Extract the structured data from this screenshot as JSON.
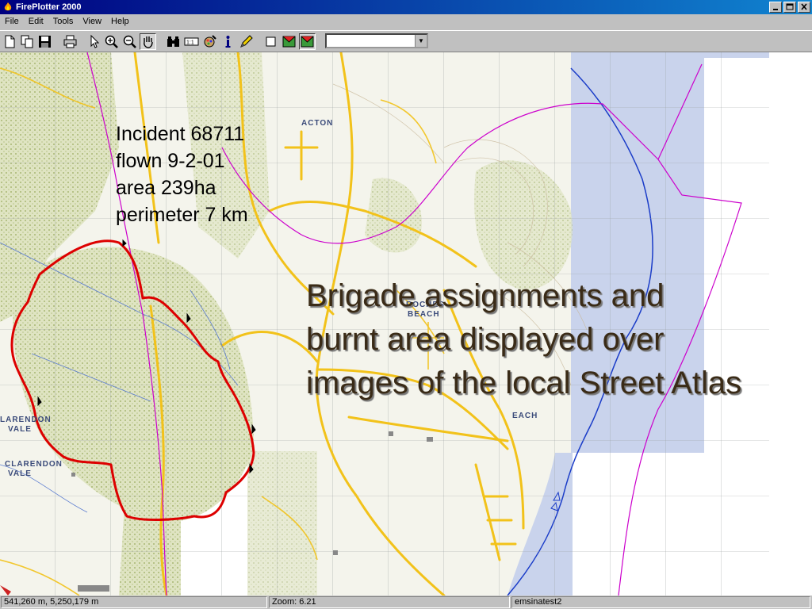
{
  "window": {
    "title": "FirePlotter 2000"
  },
  "menu": [
    {
      "label": "File"
    },
    {
      "label": "Edit"
    },
    {
      "label": "Tools"
    },
    {
      "label": "View"
    },
    {
      "label": "Help"
    }
  ],
  "toolbar": {
    "combo_value": "",
    "icons": [
      "new-icon",
      "copy-icon",
      "save-icon",
      "print-icon",
      "pointer-icon",
      "zoom-in-icon",
      "zoom-out-icon",
      "pan-hand-icon",
      "binoculars-icon",
      "measure-icon",
      "layers-icon",
      "info-icon",
      "pencil-icon",
      "rectangle-icon",
      "map-layer-icon",
      "map-layer-active-icon"
    ]
  },
  "map": {
    "incident_lines": [
      "Incident 68711",
      "flown 9-2-01",
      "area 239ha",
      "perimeter 7 km"
    ],
    "caption_lines": [
      "Brigade assignments and",
      "burnt area displayed over",
      "images of the local Street Atlas"
    ],
    "labels": {
      "acton": "ACTON",
      "roches": "ROCHES",
      "beach": "BEACH",
      "clarendon1": "LARENDON",
      "vale1": "VALE",
      "clarendon2": "CLARENDON",
      "vale2": "VALE",
      "each": "EACH"
    },
    "colors": {
      "burnt_perimeter": "#dd0000",
      "brigade_boundary": "#cc00cc",
      "water": "#c9d3ec",
      "roads": "#f2c21a",
      "forest": "#c7d39c"
    }
  },
  "status": {
    "coords": "541,260 m, 5,250,179 m",
    "zoom": "Zoom: 6.21",
    "layer": "emsinatest2"
  }
}
